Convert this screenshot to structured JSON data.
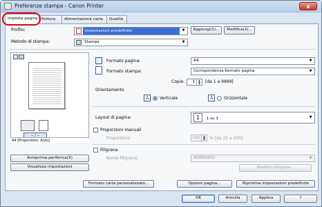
{
  "window": {
    "title": "Preferenze stampa - Canon Printer",
    "close_glyph": "x"
  },
  "tabs": [
    {
      "label": "Imposta pagina"
    },
    {
      "label": "finitura"
    },
    {
      "label": "Alimentazione carta"
    },
    {
      "label": "Qualità"
    }
  ],
  "profile": {
    "label": "Profilo:",
    "value": "Impostazioni predefinite",
    "add_button": "Aggiungi(1)...",
    "edit_button": "Modifica(2)..."
  },
  "output_method": {
    "label": "Metodo di stampa:",
    "value": "Stampa"
  },
  "preview": {
    "caption": "A4 [Proporzioni: Auto]",
    "print_preview_button": "Anteprima periferica(X)",
    "view_settings_button": "Visualizza impostazioni"
  },
  "page_size": {
    "label": "Formato pagina:",
    "value": "A4"
  },
  "output_size": {
    "label": "Formato stampa:",
    "value": "Corrispondenza formato pagina"
  },
  "copies": {
    "label": "Copie:",
    "value": "1",
    "range": "[da 1 a 9999]"
  },
  "orientation": {
    "label": "Orientamento",
    "portrait_label": "Verticale",
    "landscape_label": "Orizzontale",
    "selected": "portrait"
  },
  "page_layout": {
    "label": "Layout di pagina:",
    "number": "1",
    "value": "1 su 1"
  },
  "manual_scaling": {
    "label": "Proporzioni manuali",
    "scaling_label": "Proporzioni:",
    "scaling_value": "100",
    "scaling_range": "% [da 25 a 200]",
    "checked": false
  },
  "watermark": {
    "label": "Filigrana",
    "name_label": "Nome filigrana:",
    "name_value": "RISERVATO",
    "edit_button": "Modifica filigrana...",
    "checked": false
  },
  "bottom_buttons": {
    "custom_paper": "Formato carta personalizzato...",
    "page_options": "Opzioni pagina...",
    "restore_defaults": "Ripristina impostazioni predefinite"
  },
  "dialog_buttons": {
    "ok": "OK",
    "cancel": "Annulla",
    "apply": "Applica",
    "help": "?"
  },
  "colors": {
    "highlight_circle": "#e0001b",
    "selection_blue": "#3a6fd8"
  }
}
